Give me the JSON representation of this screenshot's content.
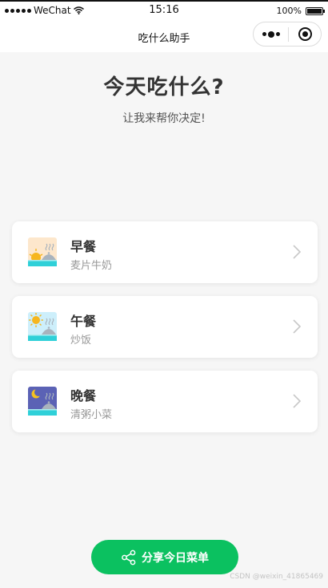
{
  "status_bar": {
    "carrier": "WeChat",
    "time": "15:16",
    "battery": "100%"
  },
  "nav": {
    "title": "吃什么助手"
  },
  "header": {
    "title": "今天吃什么?",
    "subtitle": "让我来帮你决定!"
  },
  "meals": [
    {
      "name": "早餐",
      "dish": "麦片牛奶",
      "icon": "breakfast-sunrise-icon"
    },
    {
      "name": "午餐",
      "dish": "炒饭",
      "icon": "lunch-sun-icon"
    },
    {
      "name": "晚餐",
      "dish": "清粥小菜",
      "icon": "dinner-moon-icon"
    }
  ],
  "share_button": {
    "label": "分享今日菜单",
    "icon": "share-icon"
  },
  "watermark": "CSDN @weixin_41865469",
  "colors": {
    "accent": "#0bc160",
    "background": "#f6f6f6",
    "breakfast_sky": "#fde7cc",
    "lunch_sky": "#cdeffb",
    "dinner_sky": "#5b62b5",
    "plate_base": "#2fd0d8"
  }
}
